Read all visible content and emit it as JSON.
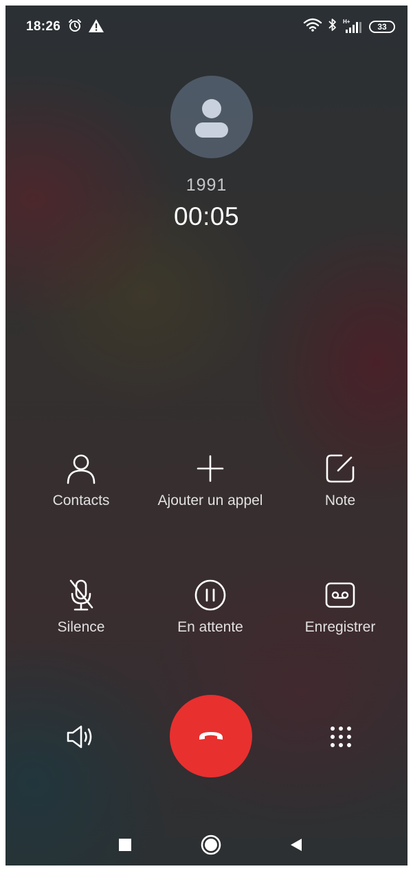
{
  "status_bar": {
    "time": "18:26",
    "network_type": "H+",
    "battery_level": "33"
  },
  "caller": {
    "number": "1991",
    "duration": "00:05"
  },
  "actions": {
    "contacts": "Contacts",
    "add_call": "Ajouter un appel",
    "note": "Note",
    "mute": "Silence",
    "hold": "En attente",
    "record": "Enregistrer"
  },
  "bottom_controls": {
    "speaker_icon": "speaker-icon",
    "hangup_icon": "phone-hangup-icon",
    "keypad_icon": "dialpad-icon"
  },
  "colors": {
    "hangup": "#e8302f",
    "avatar_bg": "#5a6b85"
  },
  "nav_bar": {
    "recents_icon": "square-icon",
    "home_icon": "circle-icon",
    "back_icon": "triangle-back-icon"
  }
}
